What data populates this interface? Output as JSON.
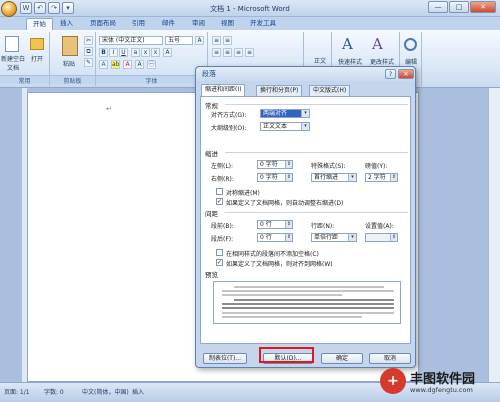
{
  "window": {
    "title": "文档 1 - Microsoft Word",
    "controls": {
      "minimize": "—",
      "maximize": "□",
      "close": "✕"
    }
  },
  "quick_access": [
    "W",
    "↶",
    "↷",
    "▾"
  ],
  "tabs": [
    {
      "label": "开始",
      "active": true
    },
    {
      "label": "插入"
    },
    {
      "label": "页面布局"
    },
    {
      "label": "引用"
    },
    {
      "label": "邮件"
    },
    {
      "label": "审阅"
    },
    {
      "label": "视图"
    },
    {
      "label": "开发工具"
    }
  ],
  "ribbon": {
    "new_doc": "新建空白文档",
    "open": "打开",
    "paste": "粘贴",
    "font_name": "宋体 (中文正文)",
    "font_size": "五号",
    "styles_quick": "快速样式",
    "styles_change": "更改样式",
    "editing": "编辑",
    "body_text": "正文",
    "groups": {
      "common": "常用",
      "clipboard": "剪贴板",
      "font": "字体"
    }
  },
  "dialog": {
    "title": "段落",
    "help": "?",
    "close": "✕",
    "tabs": [
      {
        "label": "缩进和间距(I)",
        "active": true
      },
      {
        "label": "换行和分页(P)"
      },
      {
        "label": "中文版式(H)"
      }
    ],
    "general": {
      "heading": "常规",
      "alignment_label": "对齐方式(G):",
      "alignment_value": "两端对齐",
      "outline_label": "大纲级别(O):",
      "outline_value": "正文文本"
    },
    "indent": {
      "heading": "缩进",
      "left_label": "左侧(L):",
      "left_value": "0 字符",
      "right_label": "右侧(R):",
      "right_value": "0 字符",
      "special_label": "特殊格式(S):",
      "special_value": "首行缩进",
      "by_label": "磅值(Y):",
      "by_value": "2 字符",
      "mirror": "对称缩进(M)",
      "auto_adjust": "如果定义了文档网格，则自动调整右缩进(D)"
    },
    "spacing": {
      "heading": "间距",
      "before_label": "段前(B):",
      "before_value": "0 行",
      "after_label": "段后(F):",
      "after_value": "0 行",
      "line_label": "行距(N):",
      "line_value": "单倍行距",
      "at_label": "设置值(A):",
      "at_value": "",
      "no_space": "在相同样式的段落间不添加空格(C)",
      "snap_grid": "如果定义了文档网格，则对齐到网格(W)"
    },
    "preview_heading": "预览",
    "buttons": {
      "tabs": "制表位(T)...",
      "default": "默认(D)...",
      "ok": "确定",
      "cancel": "取消"
    }
  },
  "status": {
    "page": "页面: 1/1",
    "words": "字数: 0",
    "lang": "中文(简体，中国)",
    "insert": "插入"
  },
  "watermark": {
    "brand": "丰图软件园",
    "url": "www.dgfengtu.com"
  },
  "colors": {
    "accent": "#15428b",
    "highlight": "#e01818"
  }
}
